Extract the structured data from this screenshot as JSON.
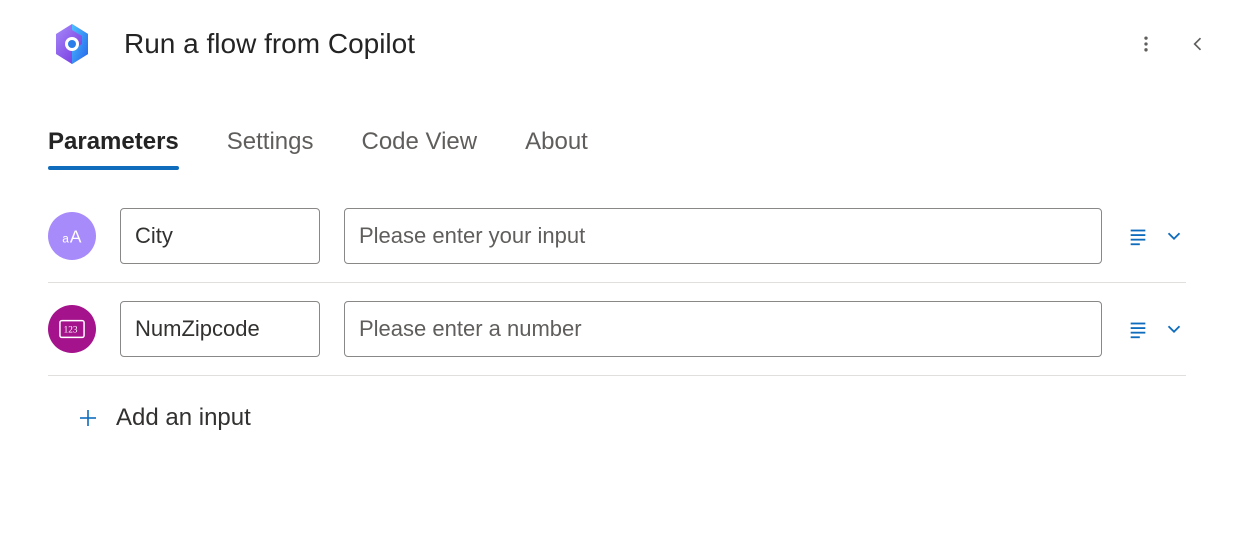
{
  "header": {
    "title": "Run a flow from Copilot"
  },
  "tabs": [
    {
      "label": "Parameters",
      "active": true
    },
    {
      "label": "Settings",
      "active": false
    },
    {
      "label": "Code View",
      "active": false
    },
    {
      "label": "About",
      "active": false
    }
  ],
  "inputs": [
    {
      "type": "text",
      "name": "City",
      "placeholder": "Please enter your input",
      "value": ""
    },
    {
      "type": "number",
      "name": "NumZipcode",
      "placeholder": "Please enter a number",
      "value": ""
    }
  ],
  "add_input_label": "Add an input"
}
